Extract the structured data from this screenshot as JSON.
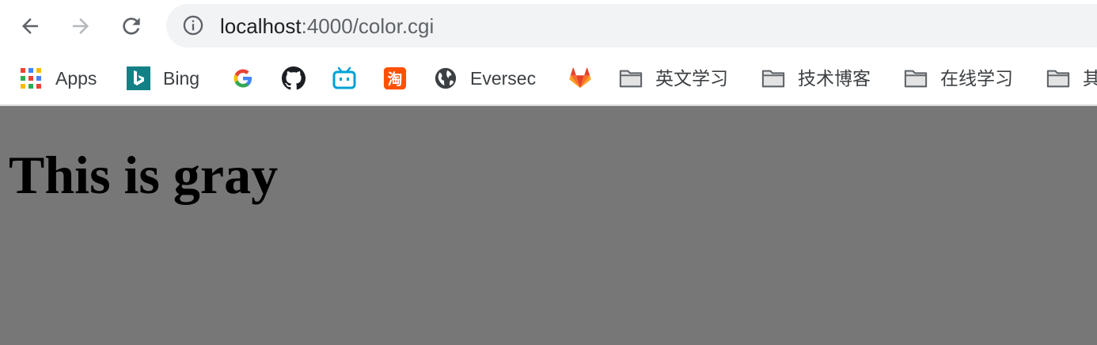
{
  "address_bar": {
    "url_host": "localhost",
    "url_path": ":4000/color.cgi"
  },
  "bookmarks": [
    {
      "label": "Apps",
      "icon": "apps-grid-icon"
    },
    {
      "label": "Bing",
      "icon": "bing-icon"
    },
    {
      "label": "",
      "icon": "google-icon"
    },
    {
      "label": "",
      "icon": "github-icon"
    },
    {
      "label": "",
      "icon": "bilibili-icon"
    },
    {
      "label": "",
      "icon": "taobao-icon"
    },
    {
      "label": "Eversec",
      "icon": "globe-icon"
    },
    {
      "label": "",
      "icon": "gitlab-icon"
    },
    {
      "label": "英文学习",
      "icon": "folder-icon"
    },
    {
      "label": "技术博客",
      "icon": "folder-icon"
    },
    {
      "label": "在线学习",
      "icon": "folder-icon"
    },
    {
      "label": "其",
      "icon": "folder-icon"
    }
  ],
  "page": {
    "heading": "This is gray",
    "background_color": "#777777"
  },
  "colors": {
    "toolbar_bg": "#ffffff",
    "omnibox_bg": "#f1f3f4",
    "content_bg": "#777777"
  }
}
